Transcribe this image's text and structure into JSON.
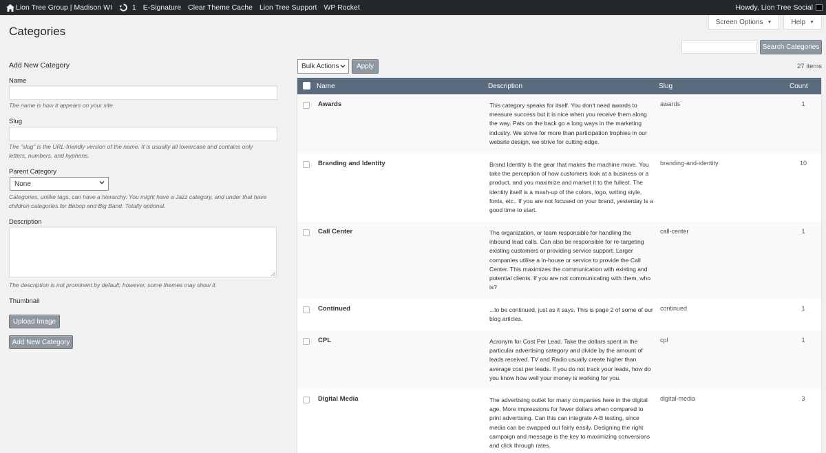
{
  "admin_bar": {
    "site_name": "Lion Tree Group | Madison WI",
    "updates_count": "1",
    "items": [
      "E-Signature",
      "Clear Theme Cache",
      "Lion Tree Support",
      "WP Rocket"
    ],
    "greeting": "Howdy, Lion Tree Social"
  },
  "screen_options": {
    "label": "Screen Options"
  },
  "help": {
    "label": "Help"
  },
  "page": {
    "title": "Categories"
  },
  "search": {
    "value": "",
    "button_label": "Search Categories"
  },
  "form": {
    "heading": "Add New Category",
    "name_label": "Name",
    "name_value": "",
    "name_hint": "The name is how it appears on your site.",
    "slug_label": "Slug",
    "slug_value": "",
    "slug_hint_1": "The “slug” is the URL-friendly version of the name. It is usually all lowercase and contains only",
    "slug_hint_2": "letters, numbers, and hyphens.",
    "parent_label": "Parent Category",
    "parent_value": "None",
    "parent_hint_1": "Categories, unlike tags, can have a hierarchy. You might have a Jazz category, and under that have",
    "parent_hint_2": "children categories for Bebop and Big Band. Totally optional.",
    "description_label": "Description",
    "description_value": "",
    "description_hint": "The description is not prominent by default; however, some themes may show it.",
    "thumbnail_label": "Thumbnail",
    "upload_label": "Upload Image",
    "submit_label": "Add New Category"
  },
  "table": {
    "bulk_actions": "Bulk Actions",
    "apply_label": "Apply",
    "items_count": "27 items",
    "columns": {
      "name": "Name",
      "description": "Description",
      "slug": "Slug",
      "count": "Count"
    },
    "rows": [
      {
        "name": "Awards",
        "description": "This category speaks for itself.  You don't need awards to measure success but it is nice when you receive them along the way.  Pats on the back go a long ways in the marketing industry. We strive for more than participation trophies in our website design, we strive for cutting edge.",
        "slug": "awards",
        "count": "1"
      },
      {
        "name": "Branding and Identity",
        "description": "Brand Identity is the gear that makes the machine move. You take the perception of how customers look at a business or a product, and you maximize and market it to the fullest.  The identity itself is a mash-up of the colors, logo, writing style, fonts, etc.. If you are not focused on your brand, yesterday is a good time to start.",
        "slug": "branding-and-identity",
        "count": "10"
      },
      {
        "name": "Call Center",
        "description": "The organization, or team responsible for handling the inbound lead calls.  Can also be responsible for re-targeting existing customers or providing service support. Larger companies utilise a in-house or service to provide the Call Center.  This maximizes the communication with existing and potential clients.  If you are not communicating with them, who is?",
        "slug": "call-center",
        "count": "1"
      },
      {
        "name": "Continued",
        "description": "...to be continued, just as it says.  This is page 2 of some of our blog articles.",
        "slug": "continued",
        "count": "1"
      },
      {
        "name": "CPL",
        "description": "Acronym for Cost Per Lead.  Take the dollars spent in the particular advertising category and divide by the amount of leads received. TV and Radio usually create higher than average cost per leads.  If you do not track your leads, how do you know how well your money is working for you.",
        "slug": "cpl",
        "count": "1"
      },
      {
        "name": "Digital Media",
        "description": "The advertising outlet for many companies here in the digital age.  More impressions for fewer dollars when compared to print advertising. Can this can integrate A-B testing, since media can be swapped out fairly easily. Designing the right campaign and message is the key to maximizing conversions and click through rates.",
        "slug": "digital-media",
        "count": "3"
      }
    ]
  }
}
